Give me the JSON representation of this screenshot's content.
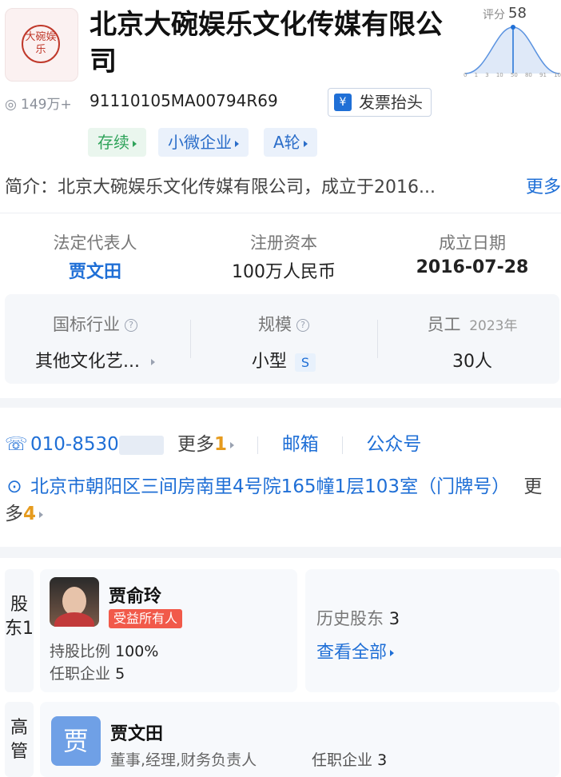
{
  "company": {
    "logo_text": "大碗娱乐",
    "name": "北京大碗娱乐文化传媒有限公司",
    "views": "149万+",
    "credit_code": "91110105MA00794R69",
    "invoice_button": "发票抬头",
    "invoice_icon": "¥",
    "tags": [
      "存续",
      "小微企业",
      "A轮"
    ],
    "intro_label": "简介：",
    "intro_text": "北京大碗娱乐文化传媒有限公司，成立于2016...",
    "intro_more": "更多"
  },
  "score": {
    "label": "评分",
    "value": "58",
    "ticks": [
      "0",
      "1",
      "3",
      "10",
      "50",
      "80",
      "91",
      "10"
    ]
  },
  "key_info": {
    "legal_rep_label": "法定代表人",
    "legal_rep_value": "贾文田",
    "capital_label": "注册资本",
    "capital_value": "100万人民币",
    "founded_label": "成立日期",
    "founded_value": "2016-07-28",
    "industry_label": "国标行业",
    "industry_value": "其他文化艺...",
    "scale_label": "规模",
    "scale_value": "小型",
    "scale_badge": "S",
    "staff_label": "员工",
    "staff_year": "2023年",
    "staff_value": "30人",
    "help_glyph": "?"
  },
  "contact": {
    "phone": "010-8530",
    "phone_more_label": "更多",
    "phone_more_count": "1",
    "email_label": "邮箱",
    "wechat_label": "公众号",
    "address": "北京市朝阳区三间房南里4号院165幢1层103室（门牌号）",
    "address_more_label": "更多",
    "address_more_count": "4"
  },
  "shareholders": {
    "section_label": "股东1",
    "name": "贾俞玲",
    "badge": "受益所有人",
    "ratio_label": "持股比例",
    "ratio_value": "100%",
    "positions_label": "任职企业",
    "positions_value": "5",
    "history_label": "历史股东",
    "history_value": "3",
    "view_all": "查看全部"
  },
  "executives": {
    "section_label": "高管",
    "avatar_char": "贾",
    "name": "贾文田",
    "roles": "董事,经理,财务负责人",
    "positions_label": "任职企业",
    "positions_value": "3"
  },
  "colors": {
    "accent": "#1f6fd6",
    "status_green": "#2fa35a",
    "badge_red": "#f15a4a",
    "count_orange": "#e69b1e"
  }
}
